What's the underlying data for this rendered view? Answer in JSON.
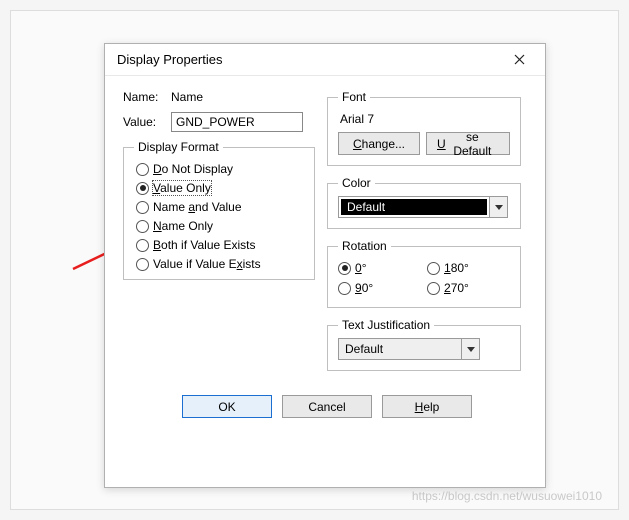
{
  "dialog": {
    "title": "Display Properties"
  },
  "name": {
    "label": "Name:",
    "value": "Name"
  },
  "value": {
    "label": "Value:",
    "input": "GND_POWER"
  },
  "display_format": {
    "legend": "Display Format",
    "options": [
      {
        "label": "Do Not Display",
        "checked": false
      },
      {
        "label": "Value Only",
        "checked": true
      },
      {
        "label": "Name and Value",
        "checked": false
      },
      {
        "label": "Name Only",
        "checked": false
      },
      {
        "label": "Both if Value Exists",
        "checked": false
      },
      {
        "label": "Value if Value Exists",
        "checked": false
      }
    ]
  },
  "font": {
    "legend": "Font",
    "info": "Arial 7",
    "change": "Change...",
    "use_default": "Use Default"
  },
  "color": {
    "legend": "Color",
    "value": "Default"
  },
  "rotation": {
    "legend": "Rotation",
    "options": [
      {
        "label": "0°",
        "checked": true
      },
      {
        "label": "180°",
        "checked": false
      },
      {
        "label": "90°",
        "checked": false
      },
      {
        "label": "270°",
        "checked": false
      }
    ]
  },
  "justification": {
    "legend": "Text Justification",
    "value": "Default"
  },
  "footer": {
    "ok": "OK",
    "cancel": "Cancel",
    "help": "Help"
  },
  "watermark": "https://blog.csdn.net/wusuowei1010"
}
